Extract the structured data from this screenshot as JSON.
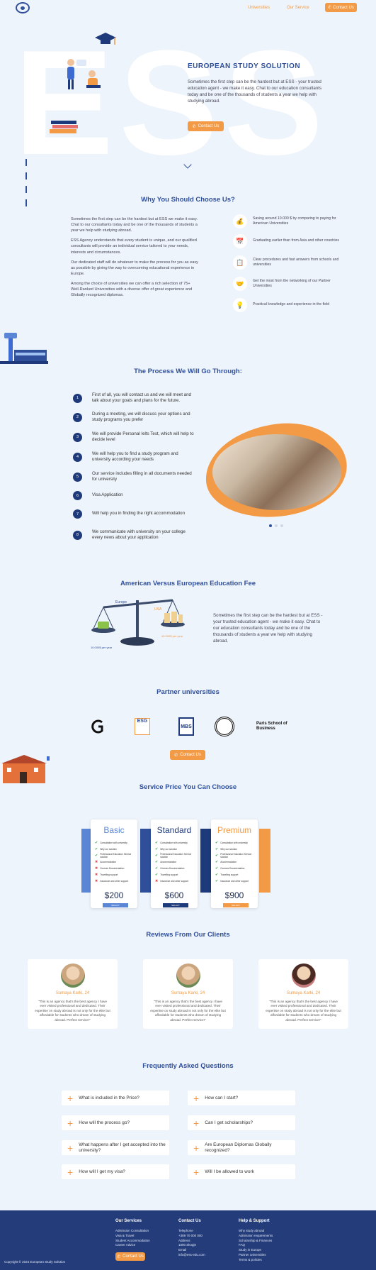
{
  "nav": {
    "links": [
      "Universities",
      "Our Service"
    ],
    "contact_label": "Contact Us"
  },
  "hero": {
    "big_letters": "ESS",
    "title": "EUROPEAN STUDY SOLUTION",
    "text": "Sometimes the first step can be the hardest but at ESS - your trusted education agent - we make it easy. Chat to our education consultants today and be one of the thousands of students a year we help with studying abroad.",
    "button_label": "Contact Us"
  },
  "why": {
    "title": "Why You Should Choose Us?",
    "paragraphs": [
      "Sometimes the first step can be the hardest but at ESS we make it easy. Chat to our consultants today and be one of the thousands of students a year we help with studying abroad.",
      "ESS Agency understands that every student is unique, and our qualified consultants will provide an individual service tailored to your needs, interests and circumstances.",
      "Our dedicated staff will do whatever to make the process for you as easy as possible by giving the way to overcoming educational experience in Europe.",
      "Among the choice of universities we can offer a rich selection of 75+ Well-Ranked Universities with a diverse offer of great experience and Globally recognized diplomas."
    ],
    "features": [
      {
        "icon": "piggy-bank-icon",
        "glyph": "💰",
        "text": "Saving around 10.000 $ by comparing to paying for American Universities"
      },
      {
        "icon": "calendar-icon",
        "glyph": "📅",
        "text": "Graduating earlier than from Asia and other countries"
      },
      {
        "icon": "checklist-icon",
        "glyph": "📋",
        "text": "Clear procedures and fast answers from schools and universities"
      },
      {
        "icon": "handshake-icon",
        "glyph": "🤝",
        "text": "Get the most from the networking of our Partner Universities"
      },
      {
        "icon": "lightbulb-icon",
        "glyph": "💡",
        "text": "Practical knowledge and experience in the field"
      }
    ]
  },
  "process": {
    "title": "The Process We Will Go Through:",
    "steps": [
      {
        "num": "1",
        "text": "First of all, you will contact us and we will meet and talk about your goals and plans for the future."
      },
      {
        "num": "2",
        "text": "During a meeting, we will discuss your options and study programs you prefer"
      },
      {
        "num": "3",
        "text": "We will provide Personal Ielts Test, which will help to decide level"
      },
      {
        "num": "4",
        "text": "We will help you to find a study program and university according your needs"
      },
      {
        "num": "5",
        "text": "Our service includes filling in all documents needed for university"
      },
      {
        "num": "6",
        "text": "Visa Application"
      },
      {
        "num": "7",
        "text": "Will help you in finding the right accommodation"
      },
      {
        "num": "8",
        "text": "We communicate with university on your college every news about your application"
      }
    ]
  },
  "fee": {
    "title": "American Versus European Education  Fee",
    "left_label": "Europe",
    "right_label": "USA",
    "left_amount": "10.000$ per year",
    "right_amount": "40.000$ per year",
    "text": "Sometimes the first step can be the hardest but at ESS - your trusted education agent - we make it easy. Chat to our education consultants today and be one of the thousands of students a year we help with studying abroad."
  },
  "partners": {
    "title": "Partner  universities",
    "names": [
      "University of Economics",
      "ESG",
      "MBS",
      "University Seal",
      "Paris School of Business"
    ],
    "button_label": "Contact Us"
  },
  "pricing": {
    "title": "Service Price You Can Choose",
    "plans": [
      {
        "name": "Basic",
        "color": "#5b86d6",
        "price": "$200",
        "button": "SELECT"
      },
      {
        "name": "Standard",
        "color": "#1f3a7a",
        "price": "$600",
        "button": "SELECT"
      },
      {
        "name": "Premium",
        "color": "#f29a45",
        "price": "$900",
        "button": "SELECT"
      }
    ],
    "features": [
      "Consultation with university",
      "Why our solution",
      "Professional Education Service solution",
      "Accommodation",
      "Courses Documentation",
      "Travelling support",
      "Insurance and other support"
    ],
    "availability": [
      [
        true,
        true,
        true,
        false,
        false,
        false,
        false
      ],
      [
        true,
        true,
        true,
        true,
        true,
        true,
        false
      ],
      [
        true,
        true,
        true,
        true,
        true,
        true,
        true
      ]
    ]
  },
  "reviews": {
    "title": "Reviews From Our Clients",
    "items": [
      {
        "name": "Sumaya Karki, 24",
        "text": "\"This is an agency that's the best agency I have ever visited professional and dedicated. Their expertise on study abroad is not only for the elite but affordable for students who dream of studying abroad. Perfect service!\""
      },
      {
        "name": "Sumaya Karki, 24",
        "text": "\"This is an agency that's the best agency I have ever visited professional and dedicated. Their expertise on study abroad is not only for the elite but affordable for students who dream of studying abroad. Perfect service!\""
      },
      {
        "name": "Sumaya Karki, 24",
        "text": "\"This is an agency that's the best agency I have ever visited professional and dedicated. Their expertise on study abroad is not only for the elite but affordable for students who dream of studying abroad. Perfect service!\""
      }
    ]
  },
  "faq": {
    "title": "Frequently Asked Questions",
    "items": [
      "What is included in the Price?",
      "How can I start?",
      "How will the process go?",
      "Can I get scholarships?",
      "What happens after I get accepted into the university?",
      "Are European Diplomas Globally recognized?",
      "How will I get my visa?",
      "Will I be allowed to work"
    ]
  },
  "footer": {
    "columns": [
      {
        "title": "Our Services",
        "items": [
          "Admission Consultation",
          "Visa & Travel",
          "Student Accommodation",
          "Career Advice"
        ]
      },
      {
        "title": "Contact Us",
        "items": [
          "Telephone",
          "+389 70 000 000",
          "Address",
          "1000 Skopje",
          "Email",
          "info@ess-edu.com"
        ]
      },
      {
        "title": "Help & Support",
        "items": [
          "Why study abroad",
          "Admission requirements",
          "Scholarship & Finances",
          "FAQ",
          "Study in Europe",
          "Partner universities",
          "Terms & policies"
        ]
      }
    ],
    "contact_label": "Contact Us",
    "copyright": "Copyright © 2024 European Study Solution"
  }
}
